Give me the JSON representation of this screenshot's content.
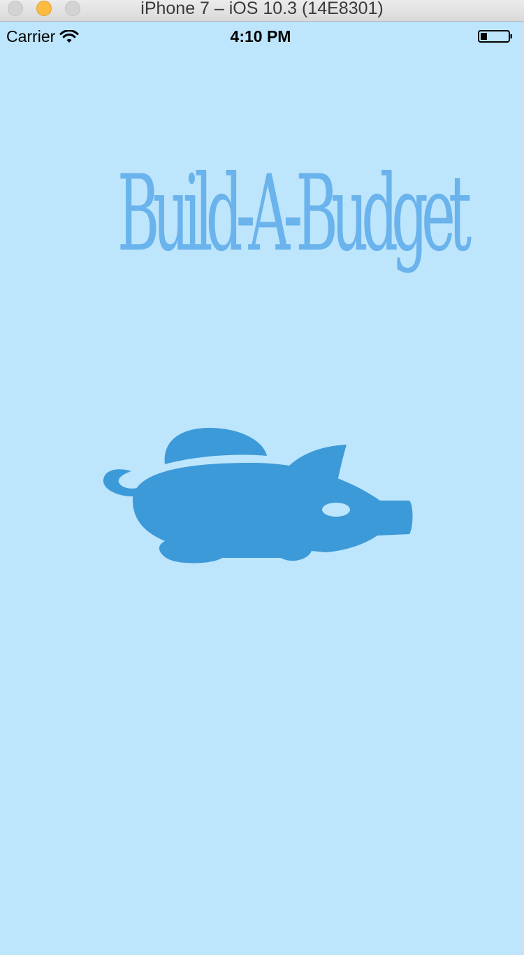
{
  "window": {
    "title": "iPhone 7 – iOS 10.3 (14E8301)"
  },
  "status_bar": {
    "carrier": "Carrier",
    "time": "4:10 PM",
    "icons": [
      "wifi-icon",
      "battery-icon"
    ]
  },
  "app": {
    "title": "Build-A-Budget",
    "logo_icon": "piggy-bank-icon"
  },
  "colors": {
    "background": "#bde5fc",
    "title": "#6ab3ec",
    "logo": "#3c9ad9"
  }
}
